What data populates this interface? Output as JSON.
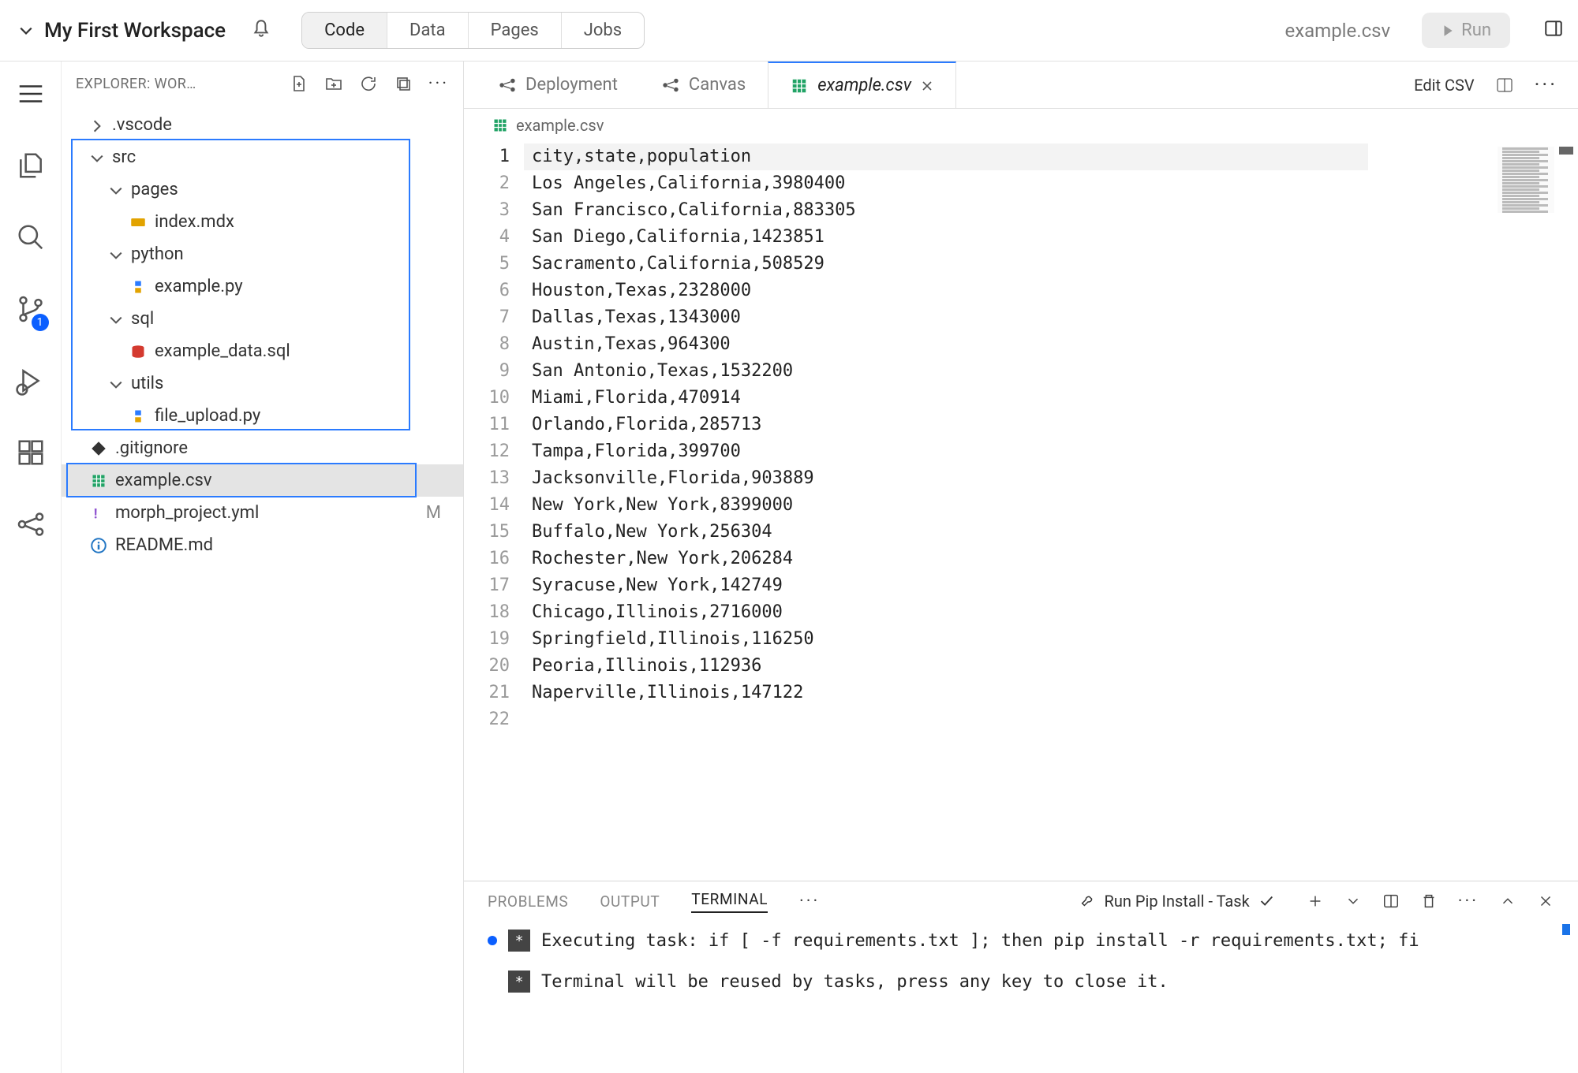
{
  "topbar": {
    "workspace": "My First Workspace",
    "tabs": {
      "code": "Code",
      "data": "Data",
      "pages": "Pages",
      "jobs": "Jobs"
    },
    "file": "example.csv",
    "run": "Run"
  },
  "activity": {
    "scm_badge": "1"
  },
  "explorer": {
    "title": "EXPLORER: WOR…",
    "tree": {
      "vscode": ".vscode",
      "src": "src",
      "pages": "pages",
      "index_mdx": "index.mdx",
      "python": "python",
      "example_py": "example.py",
      "sql": "sql",
      "example_sql": "example_data.sql",
      "utils": "utils",
      "file_upload": "file_upload.py",
      "gitignore": ".gitignore",
      "example_csv": "example.csv",
      "morph_yml": "morph_project.yml",
      "morph_yml_mod": "M",
      "readme": "README.md"
    }
  },
  "tabs": {
    "deployment": "Deployment",
    "canvas": "Canvas",
    "example_csv": "example.csv",
    "edit_csv": "Edit CSV"
  },
  "crumb": {
    "file": "example.csv"
  },
  "code": {
    "lines": [
      "city,state,population",
      "Los Angeles,California,3980400",
      "San Francisco,California,883305",
      "San Diego,California,1423851",
      "Sacramento,California,508529",
      "Houston,Texas,2328000",
      "Dallas,Texas,1343000",
      "Austin,Texas,964300",
      "San Antonio,Texas,1532200",
      "Miami,Florida,470914",
      "Orlando,Florida,285713",
      "Tampa,Florida,399700",
      "Jacksonville,Florida,903889",
      "New York,New York,8399000",
      "Buffalo,New York,256304",
      "Rochester,New York,206284",
      "Syracuse,New York,142749",
      "Chicago,Illinois,2716000",
      "Springfield,Illinois,116250",
      "Peoria,Illinois,112936",
      "Naperville,Illinois,147122",
      ""
    ]
  },
  "panel": {
    "problems": "PROBLEMS",
    "output": "OUTPUT",
    "terminal": "TERMINAL",
    "task": "Run Pip Install - Task",
    "line1": "Executing task: if [ -f requirements.txt ]; then pip install -r requirements.txt; fi",
    "line2": "Terminal will be reused by tasks, press any key to close it."
  }
}
